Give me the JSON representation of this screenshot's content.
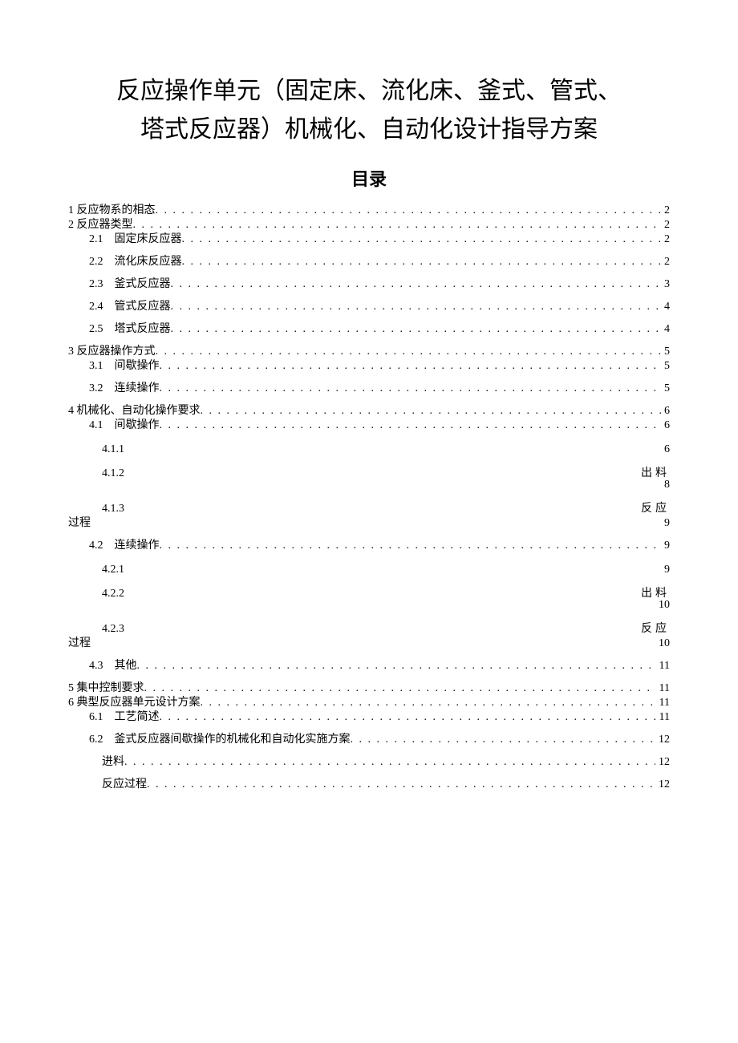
{
  "title_line1": "反应操作单元（固定床、流化床、釜式、管式、",
  "title_line2": "塔式反应器）机械化、自动化设计指导方案",
  "toc_heading": "目录",
  "toc": [
    {
      "kind": "dots",
      "indent": 0,
      "spaced": false,
      "label": "1 反应物系的相态",
      "page": "2"
    },
    {
      "kind": "dots",
      "indent": 0,
      "spaced": false,
      "label": "2 反应器类型",
      "page": "2"
    },
    {
      "kind": "dots",
      "indent": 1,
      "spaced": false,
      "label": "2.1　固定床反应器",
      "page": "2"
    },
    {
      "kind": "dots",
      "indent": 1,
      "spaced": true,
      "label": "2.2　流化床反应器",
      "page": "2"
    },
    {
      "kind": "dots",
      "indent": 1,
      "spaced": true,
      "label": "2.3　釜式反应器",
      "page": "3"
    },
    {
      "kind": "dots",
      "indent": 1,
      "spaced": true,
      "label": "2.4　管式反应器",
      "page": "4"
    },
    {
      "kind": "dots",
      "indent": 1,
      "spaced": true,
      "label": "2.5　塔式反应器",
      "page": "4"
    },
    {
      "kind": "dots",
      "indent": 0,
      "spaced": true,
      "label": "3 反应器操作方式",
      "page": "5"
    },
    {
      "kind": "dots",
      "indent": 1,
      "spaced": false,
      "label": "3.1　间歇操作",
      "page": "5"
    },
    {
      "kind": "dots",
      "indent": 1,
      "spaced": true,
      "label": "3.2　连续操作",
      "page": "5"
    },
    {
      "kind": "dots",
      "indent": 0,
      "spaced": true,
      "label": "4 机械化、自动化操作要求",
      "page": "6"
    },
    {
      "kind": "dots",
      "indent": 1,
      "spaced": false,
      "label": "4.1　间歇操作",
      "page": "6"
    },
    {
      "kind": "split",
      "indent": 2,
      "spaced": true,
      "left": "4.1.1",
      "right": "",
      "page": "6"
    },
    {
      "kind": "split",
      "indent": 2,
      "spaced": true,
      "left": "4.1.2",
      "right": "出料",
      "page": "8"
    },
    {
      "kind": "split2",
      "indent": 2,
      "spaced": true,
      "left": "4.1.3",
      "right": "反应",
      "cont": "过程",
      "page": "9"
    },
    {
      "kind": "dots",
      "indent": 1,
      "spaced": true,
      "label": "4.2　连续操作",
      "page": "9"
    },
    {
      "kind": "split",
      "indent": 2,
      "spaced": true,
      "left": "4.2.1",
      "right": "",
      "page": "9"
    },
    {
      "kind": "split",
      "indent": 2,
      "spaced": true,
      "left": "4.2.2",
      "right": "出料",
      "page": "10"
    },
    {
      "kind": "split2",
      "indent": 2,
      "spaced": true,
      "left": "4.2.3",
      "right": "反应",
      "cont": "过程",
      "page": "10"
    },
    {
      "kind": "dots",
      "indent": 1,
      "spaced": true,
      "label": "4.3　其他",
      "page": "11"
    },
    {
      "kind": "dots",
      "indent": 0,
      "spaced": true,
      "label": "5 集中控制要求",
      "page": "11"
    },
    {
      "kind": "dots",
      "indent": 0,
      "spaced": false,
      "label": "6 典型反应器单元设计方案",
      "page": "11"
    },
    {
      "kind": "dots",
      "indent": 1,
      "spaced": false,
      "label": "6.1　工艺简述",
      "page": "11"
    },
    {
      "kind": "dots",
      "indent": 1,
      "spaced": true,
      "label": "6.2　釜式反应器间歇操作的机械化和自动化实施方案",
      "page": "12"
    },
    {
      "kind": "dots",
      "indent": 2,
      "spaced": true,
      "label": "进料",
      "page": "12"
    },
    {
      "kind": "dots",
      "indent": 2,
      "spaced": true,
      "label": "反应过程",
      "page": "12"
    }
  ]
}
